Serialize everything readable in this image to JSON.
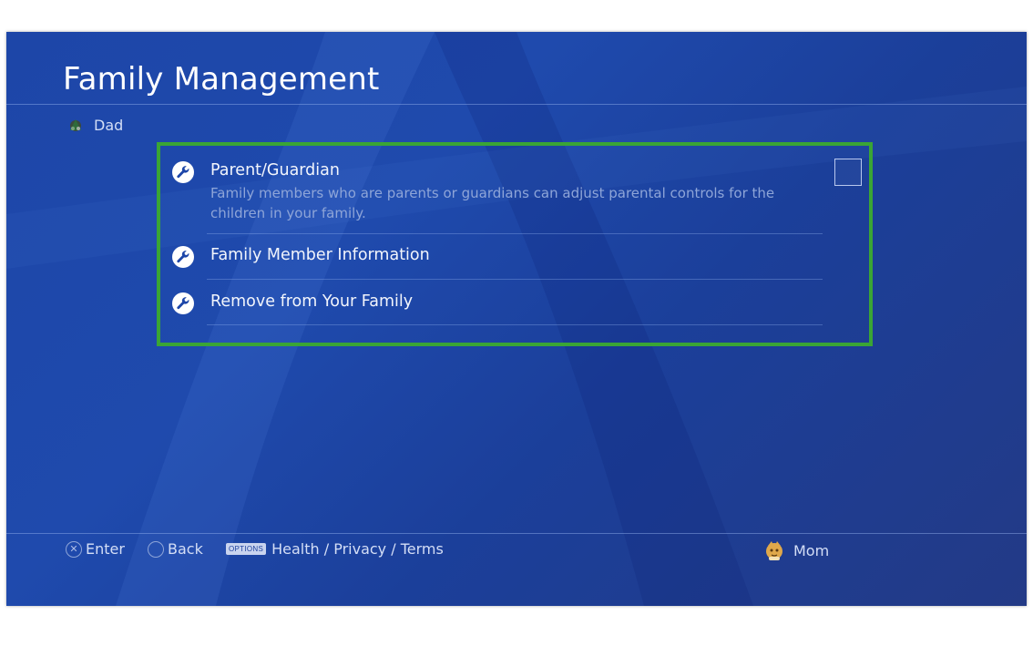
{
  "header": {
    "title": "Family Management",
    "user_name": "Dad"
  },
  "menu": {
    "items": [
      {
        "label": "Parent/Guardian",
        "description": "Family members who are parents or guardians can adjust parental controls for the children in your family.",
        "icon": "wrench-icon",
        "checkbox_checked": false
      },
      {
        "label": "Family Member Information",
        "icon": "wrench-icon"
      },
      {
        "label": "Remove from Your Family",
        "icon": "wrench-icon"
      }
    ],
    "highlight_color": "#3aa535"
  },
  "footer": {
    "enter_symbol": "✕",
    "enter_label": "Enter",
    "back_symbol": "○",
    "back_label": "Back",
    "options_symbol": "OPTIONS",
    "options_label": "Health / Privacy / Terms",
    "current_user": "Mom"
  },
  "colors": {
    "background": "#1d46a8",
    "text": "#f2f5fc",
    "muted_text": "#8ea5d8"
  }
}
